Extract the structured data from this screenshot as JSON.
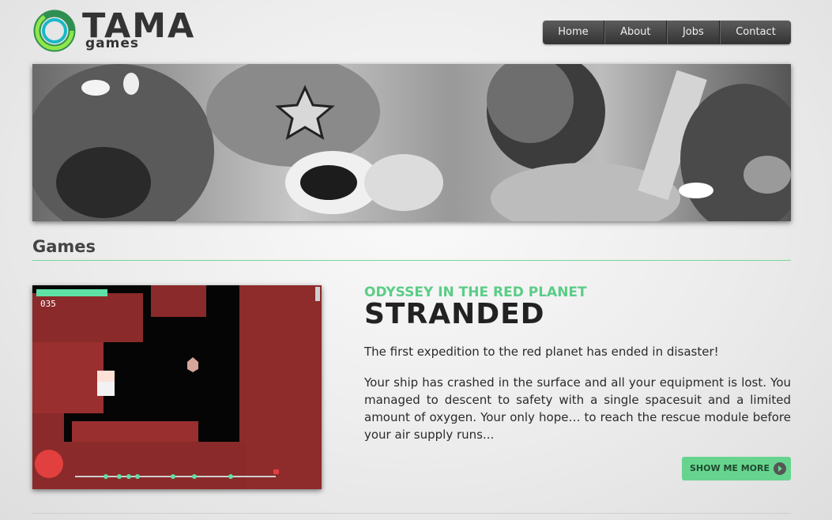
{
  "brand": {
    "name": "TAMA",
    "sub": "games",
    "accent": "#4ec97c"
  },
  "nav": {
    "items": [
      "Home",
      "About",
      "Jobs",
      "Contact"
    ]
  },
  "section": {
    "title": "Games"
  },
  "game": {
    "kicker": "ODYSSEY IN THE RED PLANET",
    "title": "STRANDED",
    "intro": "The first expedition to the red planet has ended in disaster!",
    "body": "Your ship has crashed in the surface and all your equipment is lost. You managed to descent to safety with a single spacesuit and a limited amount of oxygen. Your only hope… to reach the rescue module before your air supply runs...",
    "button_label": "SHOW ME MORE",
    "hud_counter": "035"
  },
  "colors": {
    "button": "#66d48e",
    "kicker": "#5acd86",
    "rule": "#79d49a"
  }
}
